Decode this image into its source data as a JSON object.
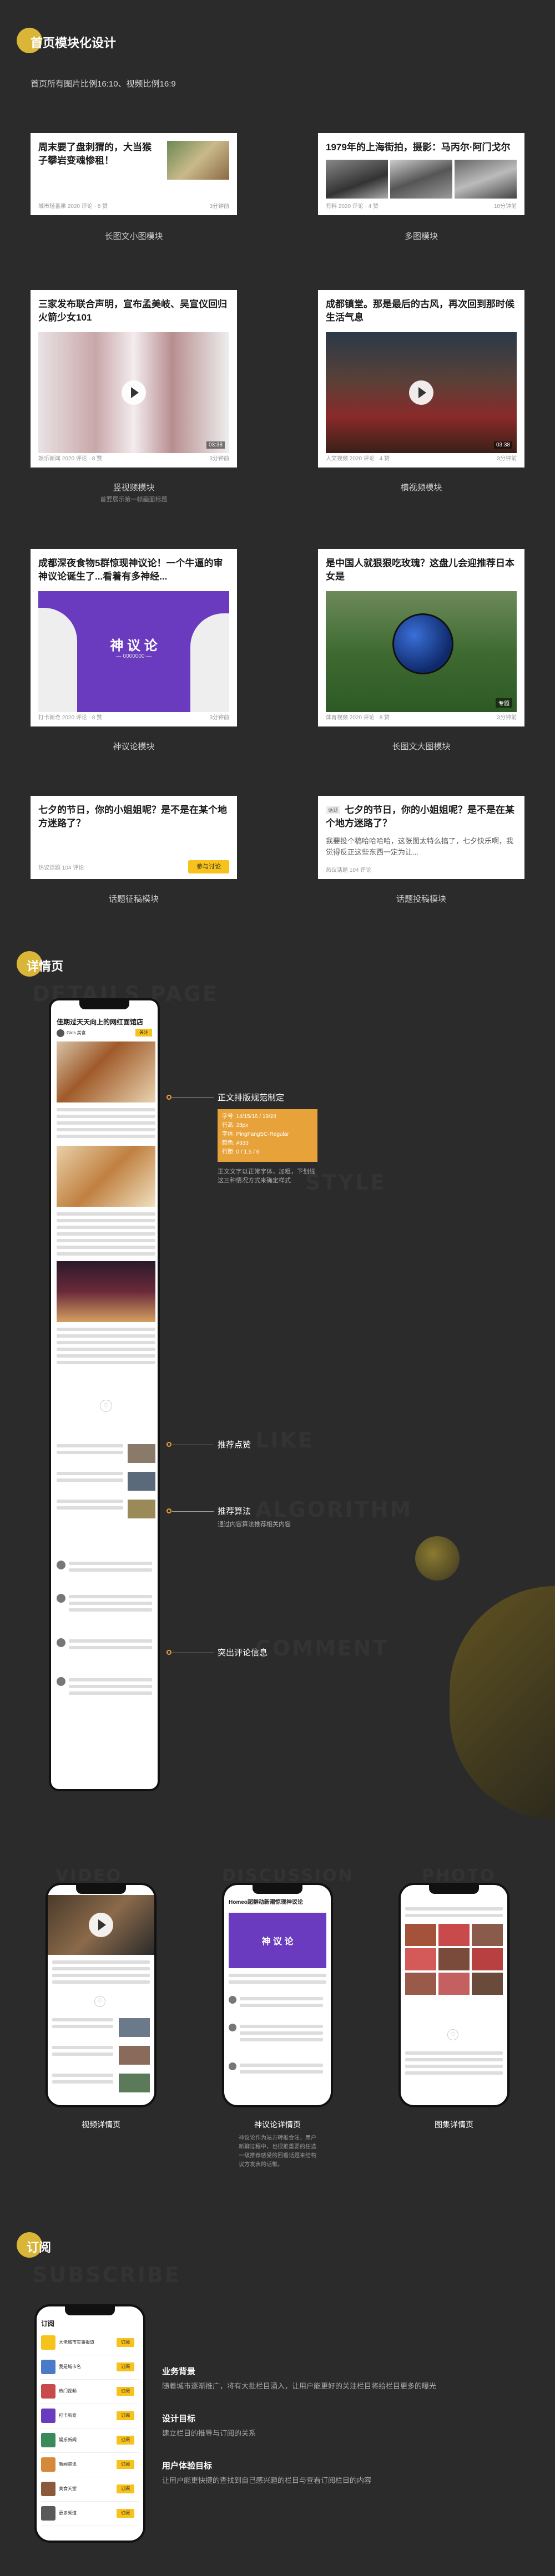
{
  "section1": {
    "title": "首页模块化设计",
    "subtitle": "首页所有图片比例16:10、视频比例16:9",
    "cards": [
      {
        "title": "周末要了盘刺猬的，大当猴子攀岩变魂惨租！",
        "meta": "城市轻番果  2020 评论 · 8 赞",
        "time": "3分钟前",
        "caption": "长图文小图模块",
        "subcaption": ""
      },
      {
        "title": "1979年的上海街拍，摄影：马丙尔·阿门戈尔",
        "meta": "有料  2020 评论 · 4 赞",
        "time": "10分钟前",
        "caption": "多图模块",
        "subcaption": ""
      },
      {
        "title": "三家发布联合声明，宣布孟美岐、吴宣仪回归火箭少女101",
        "meta": "娱乐新闻  2020 评论 · 8 赞",
        "time": "3分钟前",
        "duration": "03:38",
        "caption": "竖视频模块",
        "subcaption": "首要展示第一帧画面标题"
      },
      {
        "title": "成都镇堂。那是最后的古风，再次回到那时候生活气息",
        "meta": "人文视频  2020 评论 · 4 赞",
        "time": "3分钟前",
        "duration": "03:38",
        "caption": "横视频模块",
        "subcaption": ""
      },
      {
        "title": "成都深夜食物5群惊现神议论！一个牛逼的审神议论诞生了...看着有多神经...",
        "meta": "打卡新奇  2020 评论 · 8 赞",
        "time": "3分钟前",
        "banner": "神 议 论",
        "banner_sub": "— 0000000 —",
        "caption": "神议论模块",
        "subcaption": ""
      },
      {
        "title": "是中国人就狠狠吃玫瑰？这盘儿会迎推荐日本女是",
        "meta": "体育视频  2020 评论 · 8 赞",
        "time": "3分钟前",
        "badge": "专题",
        "caption": "长图文大图模块",
        "subcaption": ""
      },
      {
        "title": "七夕的节日，你的小姐姐呢？是不是在某个地方迷路了？",
        "meta": "热议话题  104 评论",
        "btn": "参与讨论",
        "caption": "话题征稿模块",
        "subcaption": ""
      },
      {
        "title": "话题  七夕的节日，你的小姐姐呢？是不是在某个地方迷路了？",
        "tag": "话题",
        "body": "我要投个稿哈哈哈哈，这张图太特么搞了，七夕快乐啊，我觉得反正这些东西一定为让...",
        "meta": "热议话题  104 评论",
        "caption": "话题投稿模块",
        "subcaption": ""
      }
    ]
  },
  "section2": {
    "title": "详情页",
    "ghost": [
      "DETAILS PAGE",
      "STYLE",
      "LIKE",
      "ALGORITHM",
      "COMMENT",
      "VIDEO",
      "DISCUSSION",
      "PHOTO"
    ],
    "main_phone": {
      "title": "佳期过天天向上的网红面馆店",
      "author": "Girls 美食",
      "follow": "关注"
    },
    "annotations": [
      {
        "label": "正文排版规范制定",
        "spec": [
          "字号: 14/15/16 / 19/24",
          "行高: 28px",
          "字体: PingFangSC-Regular",
          "颜色: #333",
          "行距: 0 / 1.5 / 6"
        ],
        "note": "正文文字以正常字体，加粗，下划线这三种情况方式来确定样式"
      },
      {
        "label": "推荐点赞",
        "note": ""
      },
      {
        "label": "推荐算法",
        "note": "通过内容算法推荐相关内容"
      },
      {
        "label": "突出评论信息",
        "note": ""
      }
    ],
    "phones": [
      {
        "caption": "视频详情页",
        "note": ""
      },
      {
        "caption": "神议论详情页",
        "note": "神议论作为站方转推合注，用户新聊过程中，也很推重要的任选一级推荐感受的回看话题来结构议方发表的话框。"
      },
      {
        "caption": "图集详情页",
        "note": ""
      }
    ]
  },
  "section3": {
    "title": "订阅",
    "ghost": "SUBSCRIBE",
    "phone_title": "订阅",
    "items": [
      "大佬城市实事报道",
      "我是城市名",
      "热门视频",
      "打卡新奇",
      "娱乐新闻",
      "新闻资讯",
      "美食天堂",
      "更多频道"
    ],
    "btn": "订阅",
    "blocks": [
      {
        "heading": "业务背景",
        "text": "随着城市逐渐推广，将有大批栏目涌入，让用户能更好的关注栏目将给栏目更多的曝光"
      },
      {
        "heading": "设计目标",
        "text": "建立栏目的推导与订阅的关系"
      },
      {
        "heading": "用户体验目标",
        "text": "让用户能更快捷的查找到自己感兴趣的栏目与查看订阅栏目的内容"
      }
    ]
  },
  "colors": {
    "bg": "#2b2b2b",
    "accent": "#f7c21b",
    "dot": "#d9b637",
    "orange": "#e8a23a",
    "purple": "#6a3bbf"
  }
}
